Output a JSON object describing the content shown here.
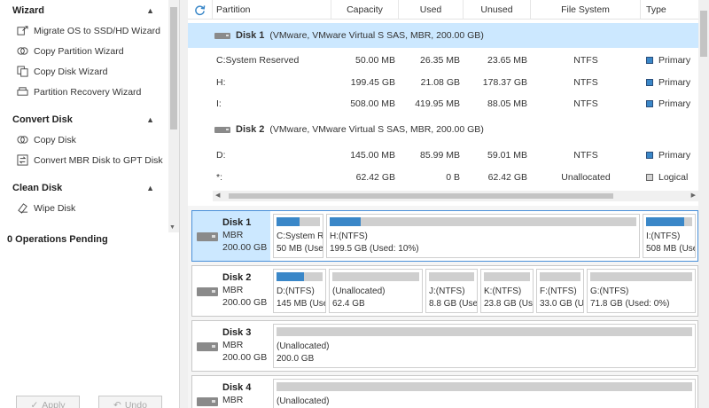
{
  "sidebar": {
    "sections": [
      {
        "title": "Wizard",
        "items": [
          {
            "label": "Migrate OS to SSD/HD Wizard",
            "icon": "migrate-icon"
          },
          {
            "label": "Copy Partition Wizard",
            "icon": "copy-partition-icon"
          },
          {
            "label": "Copy Disk Wizard",
            "icon": "copy-disk-icon"
          },
          {
            "label": "Partition Recovery Wizard",
            "icon": "recovery-icon"
          }
        ]
      },
      {
        "title": "Convert Disk",
        "items": [
          {
            "label": "Copy Disk",
            "icon": "copy-disk-icon"
          },
          {
            "label": "Convert MBR Disk to GPT Disk",
            "icon": "convert-icon"
          }
        ]
      },
      {
        "title": "Clean Disk",
        "items": [
          {
            "label": "Wipe Disk",
            "icon": "eraser-icon"
          }
        ]
      }
    ],
    "operations_pending": "0 Operations Pending",
    "apply_label": "Apply",
    "undo_label": "Undo"
  },
  "table": {
    "headers": {
      "partition": "Partition",
      "capacity": "Capacity",
      "used": "Used",
      "unused": "Unused",
      "file_system": "File System",
      "type": "Type"
    },
    "disks": [
      {
        "name": "Disk 1",
        "desc": "(VMware, VMware Virtual S SAS, MBR, 200.00 GB)",
        "selected": true,
        "partitions": [
          {
            "partition": "C:System Reserved",
            "capacity": "50.00 MB",
            "used": "26.35 MB",
            "unused": "23.65 MB",
            "fs": "NTFS",
            "type": "Primary",
            "type_color": "#3a87c8"
          },
          {
            "partition": "H:",
            "capacity": "199.45 GB",
            "used": "21.08 GB",
            "unused": "178.37 GB",
            "fs": "NTFS",
            "type": "Primary",
            "type_color": "#3a87c8"
          },
          {
            "partition": "I:",
            "capacity": "508.00 MB",
            "used": "419.95 MB",
            "unused": "88.05 MB",
            "fs": "NTFS",
            "type": "Primary",
            "type_color": "#3a87c8"
          }
        ]
      },
      {
        "name": "Disk 2",
        "desc": "(VMware, VMware Virtual S SAS, MBR, 200.00 GB)",
        "selected": false,
        "partitions": [
          {
            "partition": "D:",
            "capacity": "145.00 MB",
            "used": "85.99 MB",
            "unused": "59.01 MB",
            "fs": "NTFS",
            "type": "Primary",
            "type_color": "#3a87c8"
          },
          {
            "partition": "*:",
            "capacity": "62.42 GB",
            "used": "0 B",
            "unused": "62.42 GB",
            "fs": "Unallocated",
            "type": "Logical",
            "type_color": "#d4d4d4"
          }
        ]
      }
    ]
  },
  "disk_map": [
    {
      "name": "Disk 1",
      "type": "MBR",
      "size": "200.00 GB",
      "selected": true,
      "partitions": [
        {
          "l1": "C:System Re:",
          "l2": "50 MB (Usec",
          "used_frac": 0.53,
          "bar_color": "#3a87c8"
        },
        {
          "l1": "H:(NTFS)",
          "l2": "199.5 GB (Used: 10%)",
          "used_frac": 0.1,
          "bar_color": "#3a87c8"
        },
        {
          "l1": "I:(NTFS)",
          "l2": "508 MB (Usec",
          "used_frac": 0.83,
          "bar_color": "#3a87c8"
        }
      ]
    },
    {
      "name": "Disk 2",
      "type": "MBR",
      "size": "200.00 GB",
      "selected": false,
      "partitions": [
        {
          "l1": "D:(NTFS)",
          "l2": "145 MB (Use",
          "used_frac": 0.59,
          "bar_color": "#3a87c8"
        },
        {
          "l1": "(Unallocated)",
          "l2": "62.4 GB",
          "used_frac": 0,
          "bar_color": "#cfcfcf"
        },
        {
          "l1": "J:(NTFS)",
          "l2": "8.8 GB (Use",
          "used_frac": 0,
          "bar_color": "#cfcfcf"
        },
        {
          "l1": "K:(NTFS)",
          "l2": "23.8 GB (Use",
          "used_frac": 0,
          "bar_color": "#cfcfcf"
        },
        {
          "l1": "F:(NTFS)",
          "l2": "33.0 GB (U",
          "used_frac": 0,
          "bar_color": "#cfcfcf"
        },
        {
          "l1": "G:(NTFS)",
          "l2": "71.8 GB (Used: 0%)",
          "used_frac": 0,
          "bar_color": "#cfcfcf"
        }
      ]
    },
    {
      "name": "Disk 3",
      "type": "MBR",
      "size": "200.00 GB",
      "selected": false,
      "partitions": [
        {
          "l1": "(Unallocated)",
          "l2": "200.0 GB",
          "used_frac": 0,
          "bar_color": "#cfcfcf"
        }
      ]
    },
    {
      "name": "Disk 4",
      "type": "MBR",
      "size": "",
      "selected": false,
      "partitions": [
        {
          "l1": "(Unallocated)",
          "l2": "",
          "used_frac": 0,
          "bar_color": "#cfcfcf"
        }
      ]
    }
  ]
}
